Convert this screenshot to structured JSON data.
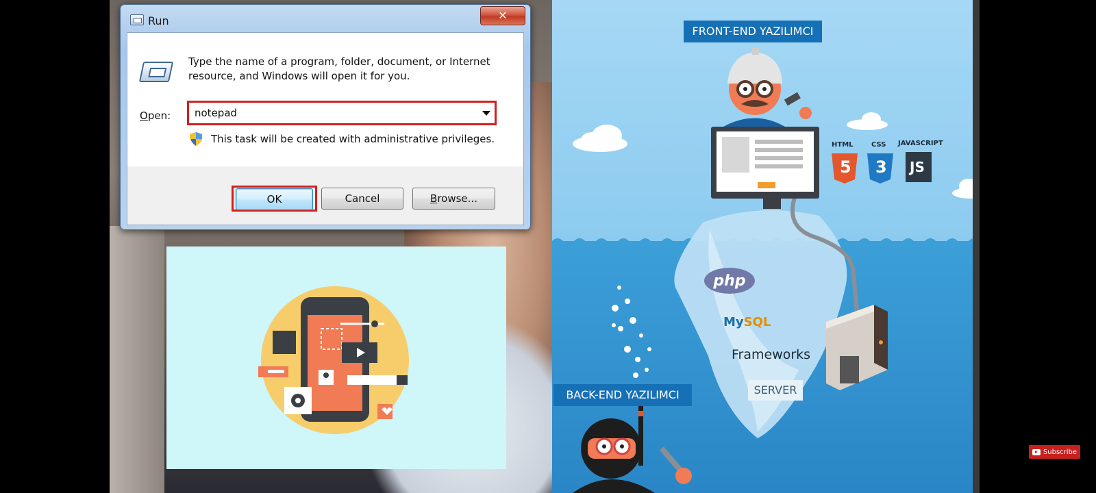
{
  "run_dialog": {
    "title": "Run",
    "close_glyph": "✕",
    "description": "Type the name of a program, folder, document, or Internet resource, and Windows will open it for you.",
    "open_label_accel": "O",
    "open_label_rest": "pen:",
    "open_value": "notepad",
    "admin_note": "This task will be created with administrative privileges.",
    "buttons": {
      "ok": "OK",
      "cancel": "Cancel",
      "browse_accel": "B",
      "browse_rest": "rowse..."
    },
    "highlight_color": "#d0201c"
  },
  "infographic": {
    "frontend_label": "FRONT-END YAZILIMCI",
    "backend_label": "BACK-END YAZILIMCI",
    "tech_labels": {
      "html": "HTML",
      "css": "CSS",
      "javascript": "JAVASCRIPT",
      "js": "JS",
      "html_number": "5",
      "css_number": "3"
    },
    "php": "php",
    "mysql_my": "My",
    "mysql_sql": "SQL",
    "frameworks": "Frameworks",
    "server": "SERVER",
    "label_color": "#1670b5"
  },
  "overlay": {
    "subscribe_label": "Subscribe",
    "subscribe_color": "#c8201e"
  },
  "icons": [
    "run-app-icon",
    "close-icon",
    "program-icon",
    "chevron-down-icon",
    "uac-shield-icon",
    "youtube-icon"
  ]
}
